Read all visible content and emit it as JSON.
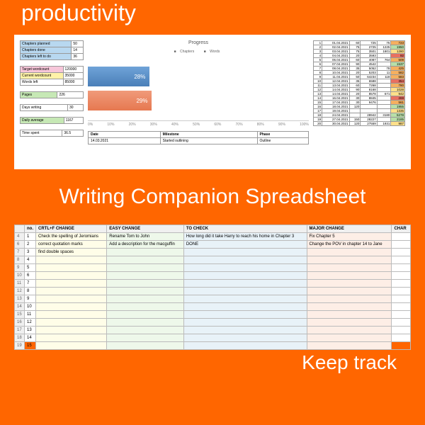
{
  "header": "productivity",
  "summary": {
    "chapters_planned": {
      "label": "Chapters planned",
      "val": "50"
    },
    "chapters_done": {
      "label": "Chapters done",
      "val": "14"
    },
    "chapters_left": {
      "label": "Chapters left to do",
      "val": "36"
    },
    "target_wc": {
      "label": "Target wordcount",
      "val": "120000"
    },
    "current_wc": {
      "label": "Current wordcount",
      "val": "35000"
    },
    "words_left": {
      "label": "Words left",
      "val": "85000"
    },
    "pages": {
      "label": "Pages",
      "val": "226"
    },
    "days_writing": {
      "label": "Days writing",
      "val": "30"
    },
    "daily_avg": {
      "label": "Daily average",
      "val": "1167"
    },
    "time_spent": {
      "label": "Time spent",
      "val": "36.5"
    }
  },
  "chart_data": {
    "type": "bar",
    "title": "Progress",
    "series": [
      {
        "name": "Chapters",
        "value": 28,
        "label": "28%"
      },
      {
        "name": "Words",
        "value": 29,
        "label": "29%"
      }
    ],
    "x_ticks": [
      "0%",
      "10%",
      "20%",
      "30%",
      "40%",
      "50%",
      "60%",
      "70%",
      "80%",
      "90%",
      "100%"
    ],
    "legend": [
      "Chapters",
      "Words"
    ]
  },
  "milestones": {
    "headers": [
      "Date",
      "Milestone",
      "Phase"
    ],
    "rows": [
      [
        "14.03.2021",
        "Started outlining",
        "Outline"
      ]
    ]
  },
  "daily": {
    "rows": [
      [
        "1",
        "01.04.2021",
        "60",
        "725",
        "75",
        "723"
      ],
      [
        "2",
        "02.04.2021",
        "75",
        "2725",
        "1225",
        "1950"
      ],
      [
        "3",
        "03.04.2021",
        "75",
        "3501",
        "1801",
        "1280"
      ],
      [
        "4",
        "04.04.2021",
        "20",
        "3593",
        "",
        "92"
      ],
      [
        "5",
        "06.04.2021",
        "60",
        "4087",
        "764",
        "509"
      ],
      [
        "6",
        "07.04.2021",
        "90",
        "4542",
        "",
        "1537"
      ],
      [
        "7",
        "08.04.2021",
        "35",
        "5052",
        "78",
        "425"
      ],
      [
        "8",
        "10.04.2021",
        "20",
        "5203",
        "11",
        "582"
      ],
      [
        "9",
        "11.04.2021",
        "50",
        "64234",
        "118",
        "583"
      ],
      [
        "10",
        "12.04.2021",
        "35",
        "6588",
        "",
        "354"
      ],
      [
        "11",
        "13.04.2021",
        "60",
        "7268",
        "",
        "780"
      ],
      [
        "12",
        "14.04.2021",
        "90",
        "8168",
        "",
        "1028"
      ],
      [
        "13",
        "14.04.2021",
        "20",
        "8578",
        "671",
        "942"
      ],
      [
        "14",
        "16.04.2021",
        "30",
        "8845",
        "",
        "269"
      ],
      [
        "15",
        "17.04.2021",
        "30",
        "9476",
        "",
        "561"
      ],
      [
        "16",
        "18.04.2021",
        "120",
        "",
        "",
        "1955"
      ],
      [
        "17",
        "19.04.2021",
        "",
        "",
        "",
        "1335"
      ],
      [
        "18",
        "24.04.2021",
        "",
        "28942",
        "3180",
        "5278"
      ],
      [
        "19",
        "27.04.2021",
        "150",
        "28227",
        "",
        "2185"
      ],
      [
        "20",
        "30.04.2021",
        "120",
        "27559",
        "1931",
        "987"
      ]
    ]
  },
  "title_band": "Writing Companion Spreadsheet",
  "changes": {
    "headers": [
      "",
      "no.",
      "CRTL+F CHANGE",
      "EASY CHANGE",
      "TO CHECK",
      "MAJOR CHANGE",
      "CHAR"
    ],
    "rows": [
      [
        "4",
        "1",
        "Check the spelling of Jeromians",
        "Rename Tom to John",
        "How long did it take Harry to reach his home in Chapter 3",
        "Fix Chapter 5",
        ""
      ],
      [
        "6",
        "2",
        "correct quotation marks",
        "Add a description for the macguffin",
        "DONE",
        "Change the POV in chapter 14 to Jane",
        ""
      ],
      [
        "7",
        "3",
        "find double spaces",
        "",
        "",
        "",
        ""
      ],
      [
        "8",
        "4",
        "",
        "",
        "",
        "",
        ""
      ],
      [
        "9",
        "5",
        "",
        "",
        "",
        "",
        ""
      ],
      [
        "10",
        "6",
        "",
        "",
        "",
        "",
        ""
      ],
      [
        "11",
        "7",
        "",
        "",
        "",
        "",
        ""
      ],
      [
        "12",
        "8",
        "",
        "",
        "",
        "",
        ""
      ],
      [
        "13",
        "9",
        "",
        "",
        "",
        "",
        ""
      ],
      [
        "14",
        "10",
        "",
        "",
        "",
        "",
        ""
      ],
      [
        "15",
        "11",
        "",
        "",
        "",
        "",
        ""
      ],
      [
        "16",
        "12",
        "",
        "",
        "",
        "",
        ""
      ],
      [
        "17",
        "13",
        "",
        "",
        "",
        "",
        ""
      ],
      [
        "18",
        "14",
        "",
        "",
        "",
        "",
        ""
      ],
      [
        "19",
        "15",
        "",
        "",
        "",
        "",
        ""
      ]
    ]
  },
  "footer": "Keep track"
}
